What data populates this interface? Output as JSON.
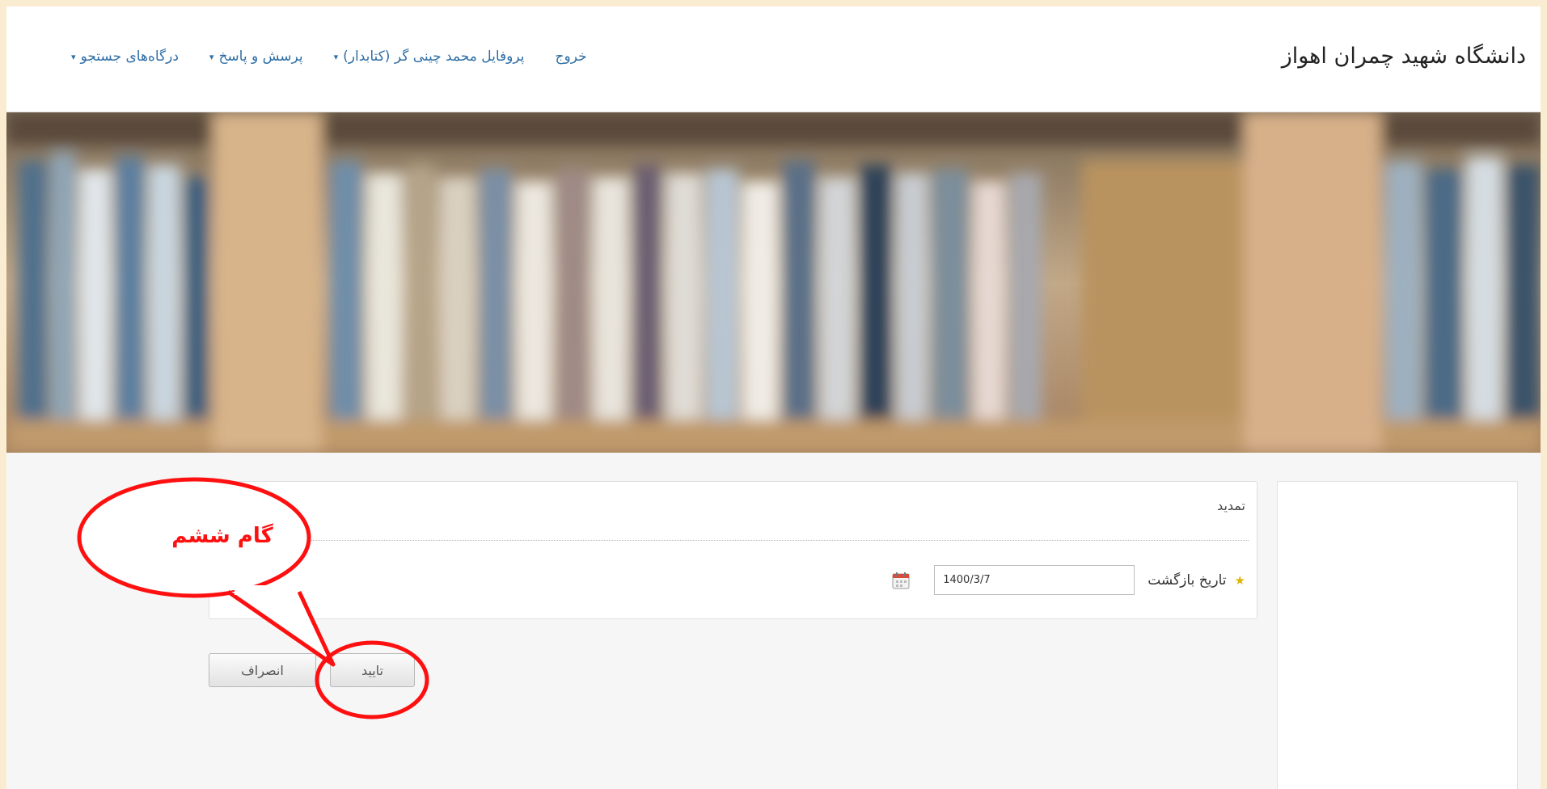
{
  "header": {
    "site_title": "دانشگاه شهید چمران اهواز",
    "nav": [
      {
        "label": "درگاه‌های جستجو",
        "caret": "▾"
      },
      {
        "label": "پرسش و پاسخ",
        "caret": "▾"
      },
      {
        "label": "پروفایل محمد چینی گر (کتابدار)",
        "caret": "▾"
      },
      {
        "label": "خروج",
        "caret": ""
      }
    ]
  },
  "form": {
    "title": "تمدید",
    "return_date_label": "تاریخ بازگشت",
    "required_mark": "★",
    "return_date_value": "1400/3/7"
  },
  "buttons": {
    "confirm": "تایید",
    "cancel": "انصراف"
  },
  "annotation": {
    "text": "گام ششم",
    "color": "#ff1010"
  },
  "colors": {
    "nav_link": "#2f6ea5",
    "page_border": "#faecd0"
  }
}
